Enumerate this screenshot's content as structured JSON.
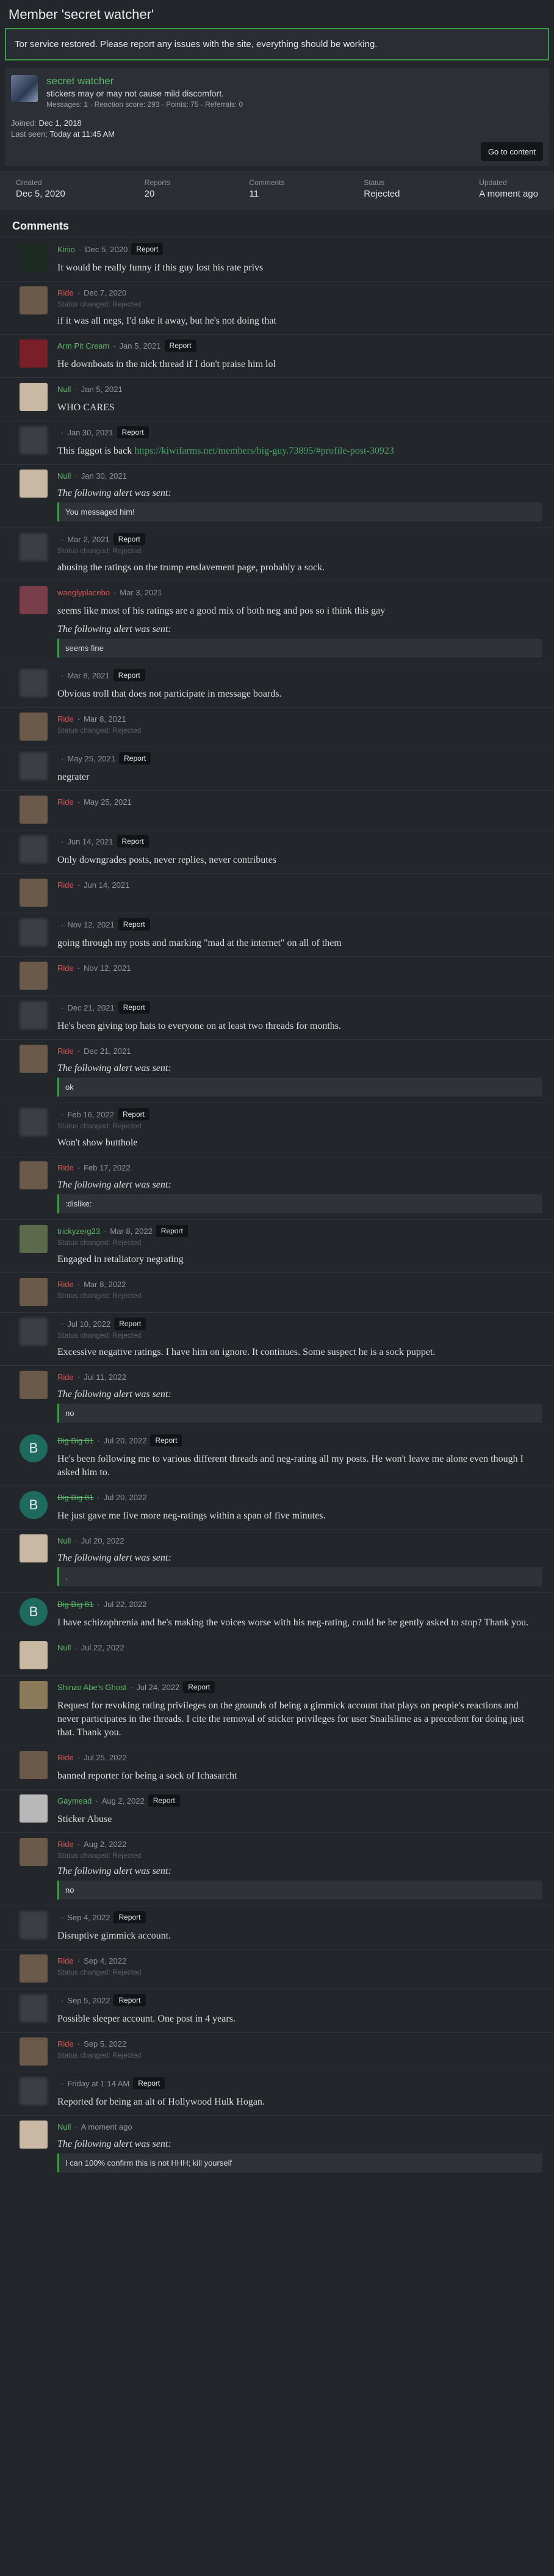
{
  "page": {
    "title": "Member 'secret watcher'"
  },
  "notice": "Tor service restored. Please report any issues with the site, everything should be working.",
  "member": {
    "name": "secret watcher",
    "custom_title": "stickers may or may not cause mild discomfort.",
    "stats": "Messages: 1 · Reaction score: 293 · Points: 75 · Referrals: 0",
    "joined_label": "Joined:",
    "joined": "Dec 1, 2018",
    "last_seen_label": "Last seen:",
    "last_seen": "Today at 11:45 AM",
    "goto_label": "Go to content"
  },
  "report_stats": [
    {
      "label": "Created",
      "value": "Dec 5, 2020"
    },
    {
      "label": "Reports",
      "value": "20"
    },
    {
      "label": "Comments",
      "value": "11"
    },
    {
      "label": "Status",
      "value": "Rejected"
    },
    {
      "label": "Updated",
      "value": "A moment ago"
    }
  ],
  "comments_heading": "Comments",
  "report_label": "Report",
  "status_text": "Status changed: Rejected",
  "alert_label": "The following alert was sent:",
  "comments": [
    {
      "author": "Kiriio",
      "date": "Dec 5, 2020",
      "cls": "",
      "avatar": "#1d2a22",
      "report": true,
      "text": "It would be really funny if this guy lost his rate privs"
    },
    {
      "author": "Ride",
      "date": "Dec 7, 2020",
      "cls": "red",
      "avatar": "#6b5a4a",
      "status": true,
      "text": "if it was all negs, I'd take it away, but he's not doing that"
    },
    {
      "author": "Arm Pit Cream",
      "date": "Jan 5, 2021",
      "cls": "",
      "avatar": "#7a1f28",
      "report": true,
      "text": "He downboats in the nick thread if I don't praise him lol"
    },
    {
      "author": "Null",
      "date": "Jan 5, 2021",
      "cls": "",
      "avatar": "#c9b9a2",
      "text": "WHO CARES"
    },
    {
      "author": "",
      "date": "Jan 30, 2021",
      "cls": "gray",
      "avatar": "#3b3e44",
      "report": true,
      "blur": true,
      "text": "This faggot is back ",
      "link": "https://kiwifarms.net/members/big-guy.73895/#profile-post-30923"
    },
    {
      "author": "Null",
      "date": "Jan 30, 2021",
      "cls": "",
      "avatar": "#c9b9a2",
      "alert": "You messaged him!"
    },
    {
      "author": "",
      "date": "Mar 2, 2021",
      "cls": "gray",
      "avatar": "#3b3e44",
      "report": true,
      "status": true,
      "blur": true,
      "text": "abusing the ratings on the trump enslavement page, probably a sock."
    },
    {
      "author": "waeglyplacebo",
      "date": "Mar 3, 2021",
      "cls": "red",
      "avatar": "#7a3d4a",
      "text": "seems like most of his ratings are a good mix of both neg and pos so i think this gay",
      "alert": "seems fine"
    },
    {
      "author": "",
      "date": "Mar 8, 2021",
      "cls": "gray",
      "avatar": "#3b3e44",
      "report": true,
      "blur": true,
      "text": "Obvious troll that does not participate in message boards."
    },
    {
      "author": "Ride",
      "date": "Mar 8, 2021",
      "cls": "red",
      "avatar": "#6b5a4a",
      "status": true
    },
    {
      "author": "",
      "date": "May 25, 2021",
      "cls": "gray",
      "avatar": "#3b3e44",
      "report": true,
      "blur": true,
      "text": "negrater"
    },
    {
      "author": "Ride",
      "date": "May 25, 2021",
      "cls": "red",
      "avatar": "#6b5a4a"
    },
    {
      "author": "",
      "date": "Jun 14, 2021",
      "cls": "gray",
      "avatar": "#3b3e44",
      "report": true,
      "blur": true,
      "text": "Only downgrades posts, never replies, never contributes"
    },
    {
      "author": "Ride",
      "date": "Jun 14, 2021",
      "cls": "red",
      "avatar": "#6b5a4a"
    },
    {
      "author": "",
      "date": "Nov 12, 2021",
      "cls": "gray",
      "avatar": "#3b3e44",
      "report": true,
      "blur": true,
      "text": "going through my posts and marking \"mad at the internet\" on all of them"
    },
    {
      "author": "Ride",
      "date": "Nov 12, 2021",
      "cls": "red",
      "avatar": "#6b5a4a"
    },
    {
      "author": "",
      "date": "Dec 21, 2021",
      "cls": "gray",
      "avatar": "#3b3e44",
      "report": true,
      "blur": true,
      "text": "He's been giving top hats to everyone on at least two threads for months."
    },
    {
      "author": "Ride",
      "date": "Dec 21, 2021",
      "cls": "red",
      "avatar": "#6b5a4a",
      "alert": "ok"
    },
    {
      "author": "",
      "date": "Feb 16, 2022",
      "cls": "gray",
      "avatar": "#3b3e44",
      "report": true,
      "status": true,
      "blur": true,
      "text": "Won't show butthole"
    },
    {
      "author": "Ride",
      "date": "Feb 17, 2022",
      "cls": "red",
      "avatar": "#6b5a4a",
      "alert": ":dislike:"
    },
    {
      "author": "trickyzerg23",
      "date": "Mar 8, 2022",
      "cls": "",
      "avatar": "#5a6a4a",
      "report": true,
      "status": true,
      "text": "Engaged in retaliatory negrating"
    },
    {
      "author": "Ride",
      "date": "Mar 8, 2022",
      "cls": "red",
      "avatar": "#6b5a4a",
      "status": true
    },
    {
      "author": "",
      "date": "Jul 10, 2022",
      "cls": "gray",
      "avatar": "#3b3e44",
      "report": true,
      "status": true,
      "blur": true,
      "text": "Excessive negative ratings. I have him on ignore. It continues. Some suspect he is a sock puppet."
    },
    {
      "author": "Ride",
      "date": "Jul 11, 2022",
      "cls": "red",
      "avatar": "#6b5a4a",
      "alert": "no"
    },
    {
      "author": "Big Big 81",
      "date": "Jul 20, 2022",
      "cls": "strike",
      "avatar": "#1e6a5e",
      "letter": "B",
      "report": true,
      "text": "He's been following me to various different threads and neg-rating all my posts. He won't leave me alone even though I asked him to."
    },
    {
      "author": "Big Big 81",
      "date": "Jul 20, 2022",
      "cls": "strike",
      "avatar": "#1e6a5e",
      "letter": "B",
      "text": "He just gave me five more neg-ratings within a span of five minutes."
    },
    {
      "author": "Null",
      "date": "Jul 20, 2022",
      "cls": "",
      "avatar": "#c9b9a2",
      "alert": "."
    },
    {
      "author": "Big Big 81",
      "date": "Jul 22, 2022",
      "cls": "strike",
      "avatar": "#1e6a5e",
      "letter": "B",
      "text": "I have schizophrenia and he's making the voices worse with his neg-rating, could he be gently asked to stop? Thank you."
    },
    {
      "author": "Null",
      "date": "Jul 22, 2022",
      "cls": "",
      "avatar": "#c9b9a2"
    },
    {
      "author": "Shinzo Abe's Ghost",
      "date": "Jul 24, 2022",
      "cls": "",
      "avatar": "#8a7a5a",
      "report": true,
      "text": "Request for revoking rating privileges on the grounds of being a gimmick account that plays on people's reactions and never participates in the threads. I cite the removal of sticker privileges for user Snailslime as a precedent for doing just that. Thank you."
    },
    {
      "author": "Ride",
      "date": "Jul 25, 2022",
      "cls": "red",
      "avatar": "#6b5a4a",
      "text": "banned reporter for being a sock of Ichasarcht"
    },
    {
      "author": "Gaymead",
      "date": "Aug 2, 2022",
      "cls": "",
      "avatar": "#b8b8b8",
      "report": true,
      "text": "Sticker Abuse"
    },
    {
      "author": "Ride",
      "date": "Aug 2, 2022",
      "cls": "red",
      "avatar": "#6b5a4a",
      "status": true,
      "alert": "no"
    },
    {
      "author": "",
      "date": "Sep 4, 2022",
      "cls": "gray",
      "avatar": "#3b3e44",
      "report": true,
      "blur": true,
      "text": "Disruptive gimmick account."
    },
    {
      "author": "Ride",
      "date": "Sep 4, 2022",
      "cls": "red",
      "avatar": "#6b5a4a",
      "status": true
    },
    {
      "author": "",
      "date": "Sep 5, 2022",
      "cls": "gray",
      "avatar": "#3b3e44",
      "report": true,
      "blur": true,
      "text": "Possible sleeper account. One post in 4 years."
    },
    {
      "author": "Ride",
      "date": "Sep 5, 2022",
      "cls": "red",
      "avatar": "#6b5a4a",
      "status": true
    },
    {
      "author": "",
      "date": "Friday at 1:14 AM",
      "cls": "gray",
      "avatar": "#3b3e44",
      "report": true,
      "blur": true,
      "text": "Reported for being an alt of Hollywood Hulk Hogan."
    },
    {
      "author": "Null",
      "date": "A moment ago",
      "cls": "",
      "avatar": "#c9b9a2",
      "alert": "I can 100% confirm this is not HHH; kill yourself"
    }
  ]
}
